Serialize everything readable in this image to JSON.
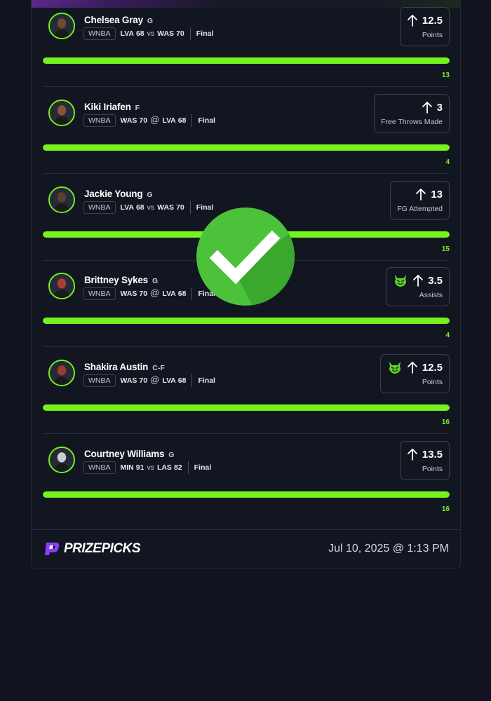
{
  "picks": [
    {
      "name": "Chelsea Gray",
      "position": "G",
      "league": "WNBA",
      "team1": "LVA",
      "score1": "68",
      "connector": "vs",
      "team2": "WAS",
      "score2": "70",
      "status": "Final",
      "line": "12.5",
      "stat": "Points",
      "demon": false,
      "actual": "13",
      "progress_fraction": 1.0,
      "avatar_bg": "#6e4a32"
    },
    {
      "name": "Kiki Iriafen",
      "position": "F",
      "league": "WNBA",
      "team1": "WAS",
      "score1": "70",
      "connector": "@",
      "team2": "LVA",
      "score2": "68",
      "status": "Final",
      "line": "3",
      "stat": "Free Throws Made",
      "demon": false,
      "actual": "4",
      "progress_fraction": 1.0,
      "avatar_bg": "#8a5236"
    },
    {
      "name": "Jackie Young",
      "position": "G",
      "league": "WNBA",
      "team1": "LVA",
      "score1": "68",
      "connector": "vs",
      "team2": "WAS",
      "score2": "70",
      "status": "Final",
      "line": "13",
      "stat": "FG Attempted",
      "demon": false,
      "actual": "15",
      "progress_fraction": 1.0,
      "avatar_bg": "#5c3e2c"
    },
    {
      "name": "Brittney Sykes",
      "position": "G",
      "league": "WNBA",
      "team1": "WAS",
      "score1": "70",
      "connector": "@",
      "team2": "LVA",
      "score2": "68",
      "status": "Final",
      "line": "3.5",
      "stat": "Assists",
      "demon": true,
      "actual": "4",
      "progress_fraction": 1.0,
      "avatar_bg": "#b23a36"
    },
    {
      "name": "Shakira Austin",
      "position": "C-F",
      "league": "WNBA",
      "team1": "WAS",
      "score1": "70",
      "connector": "@",
      "team2": "LVA",
      "score2": "68",
      "status": "Final",
      "line": "12.5",
      "stat": "Points",
      "demon": true,
      "actual": "16",
      "progress_fraction": 1.0,
      "avatar_bg": "#9a3a32"
    },
    {
      "name": "Courtney Williams",
      "position": "G",
      "league": "WNBA",
      "team1": "MIN",
      "score1": "91",
      "connector": "vs",
      "team2": "LAS",
      "score2": "82",
      "status": "Final",
      "line": "13.5",
      "stat": "Points",
      "demon": false,
      "actual": "16",
      "progress_fraction": 1.0,
      "avatar_bg": "#c9cdd4"
    }
  ],
  "footer": {
    "brand": "PRIZEPICKS",
    "date": "Jul 10, 2025 @ 1:13 PM"
  },
  "colors": {
    "accent_green": "#75f31e",
    "brand_purple": "#8b3dff",
    "check_green": "#4cc23a",
    "background": "#111420"
  },
  "overlay": {
    "icon": "checkmark-icon",
    "state": "won"
  }
}
